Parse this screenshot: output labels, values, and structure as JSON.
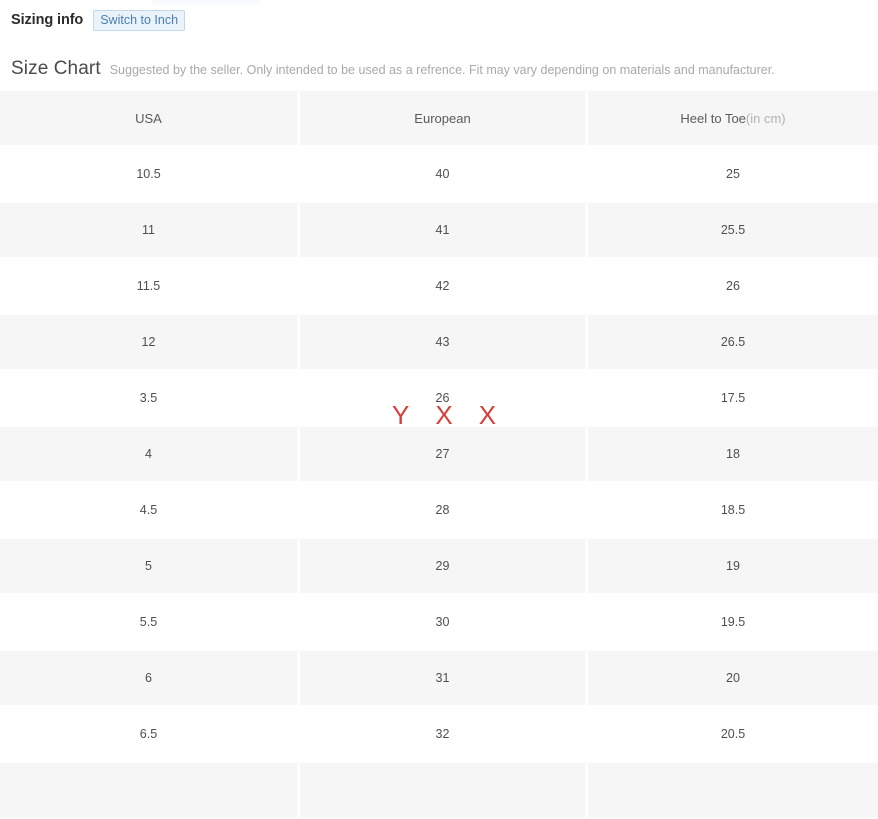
{
  "header": {
    "title": "Sizing info",
    "switch_button_label": "Switch to Inch"
  },
  "size_chart": {
    "heading": "Size Chart",
    "note": "Suggested by the seller. Only intended to be used as a refrence. Fit may vary depending on materials and manufacturer.",
    "columns": [
      {
        "label": "USA",
        "suffix": ""
      },
      {
        "label": "European",
        "suffix": ""
      },
      {
        "label": "Heel to Toe",
        "suffix": "(in cm)"
      }
    ],
    "rows": [
      {
        "usa": "10.5",
        "european": "40",
        "heel_to_toe": "25"
      },
      {
        "usa": "11",
        "european": "41",
        "heel_to_toe": "25.5"
      },
      {
        "usa": "11.5",
        "european": "42",
        "heel_to_toe": "26"
      },
      {
        "usa": "12",
        "european": "43",
        "heel_to_toe": "26.5"
      },
      {
        "usa": "3.5",
        "european": "26",
        "heel_to_toe": "17.5"
      },
      {
        "usa": "4",
        "european": "27",
        "heel_to_toe": "18"
      },
      {
        "usa": "4.5",
        "european": "28",
        "heel_to_toe": "18.5"
      },
      {
        "usa": "5",
        "european": "29",
        "heel_to_toe": "19"
      },
      {
        "usa": "5.5",
        "european": "30",
        "heel_to_toe": "19.5"
      },
      {
        "usa": "6",
        "european": "31",
        "heel_to_toe": "20"
      },
      {
        "usa": "6.5",
        "european": "32",
        "heel_to_toe": "20.5"
      },
      {
        "usa": "",
        "european": "",
        "heel_to_toe": ""
      }
    ]
  },
  "annotation": {
    "marks": [
      "Y",
      "X",
      "X"
    ],
    "color": "#d6403a"
  },
  "colors": {
    "accent_link": "#4a7fb5",
    "button_bg": "#eaf2fa",
    "row_alt_bg": "#f6f6f6",
    "text": "#4f4f4f",
    "muted_text": "#a9a9a9"
  }
}
